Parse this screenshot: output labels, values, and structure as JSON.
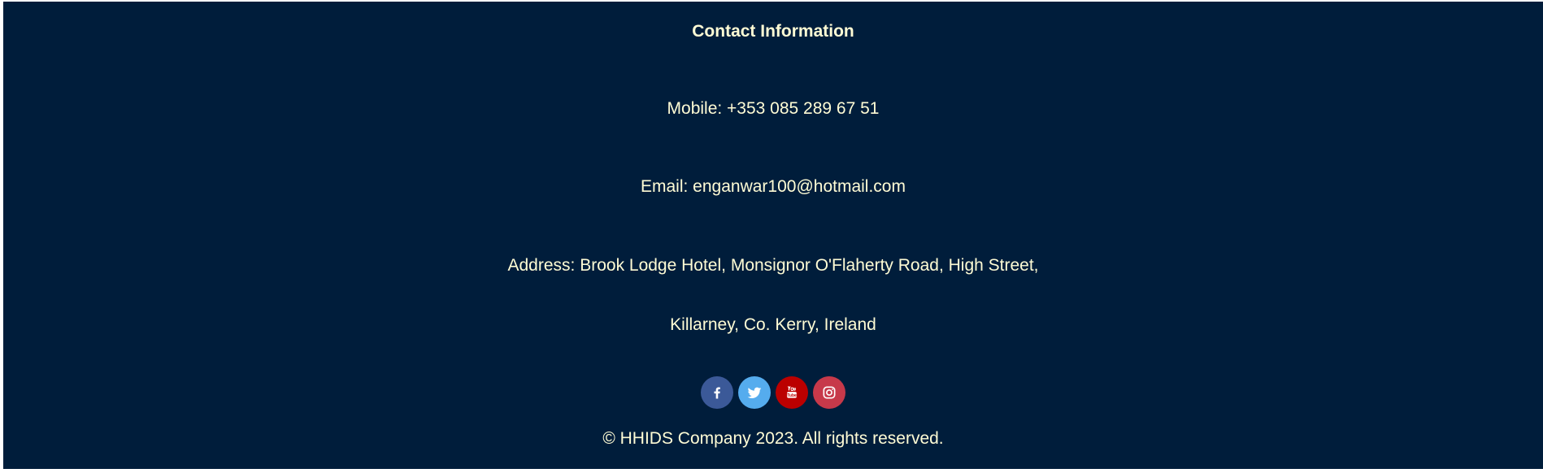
{
  "contact": {
    "heading": "Contact Information",
    "mobile": "Mobile: +353 085 289 67 51",
    "email": "Email: enganwar100@hotmail.com",
    "address_line1": "Address: Brook Lodge Hotel, Monsignor O'Flaherty Road, High Street,",
    "address_line2": "Killarney, Co. Kerry, Ireland"
  },
  "social": {
    "icons": [
      "facebook-icon",
      "twitter-icon",
      "youtube-icon",
      "instagram-icon"
    ],
    "colors": {
      "facebook": "#3b5998",
      "twitter": "#55acee",
      "youtube": "#bb0000",
      "instagram": "#c7394a"
    }
  },
  "copyright": "© HHIDS Company 2023. All rights reserved.",
  "theme": {
    "background": "#001d3b",
    "text": "#fffcd5"
  }
}
